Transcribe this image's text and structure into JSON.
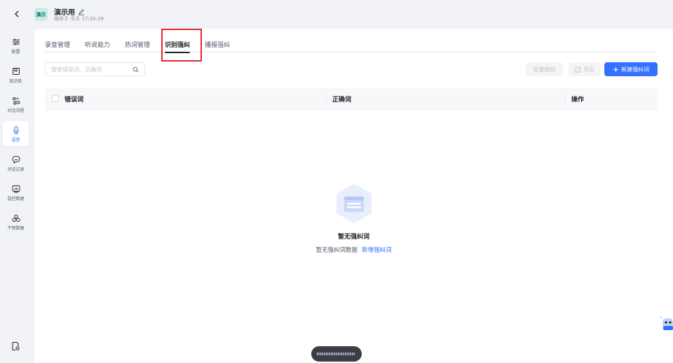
{
  "header": {
    "back_icon": "chevron-left-icon",
    "badge": "演示",
    "title": "演示用",
    "edit_icon": "pencil-icon",
    "save_status": "保存于 今天 17:20:39"
  },
  "sidebar": {
    "items": [
      {
        "label": "配置",
        "icon": "sliders-icon"
      },
      {
        "label": "知识库",
        "icon": "book-icon"
      },
      {
        "label": "对话流程",
        "icon": "flow-icon"
      },
      {
        "label": "语音",
        "icon": "microphone-icon",
        "active": true
      },
      {
        "label": "对话记录",
        "icon": "chat-icon"
      },
      {
        "label": "监控数据",
        "icon": "monitor-chart-icon"
      },
      {
        "label": "干预数据",
        "icon": "nodes-icon"
      }
    ],
    "bottom_icon": "document-settings-icon"
  },
  "tabs": [
    {
      "label": "录音管理"
    },
    {
      "label": "听说能力"
    },
    {
      "label": "热词管理"
    },
    {
      "label": "识别强纠",
      "active": true
    },
    {
      "label": "播报强纠"
    }
  ],
  "search": {
    "placeholder": "搜索错误词、正确词"
  },
  "actions": {
    "batch_delete": "批量删除",
    "export": "导出",
    "new": "新建强纠词"
  },
  "table": {
    "columns": [
      "错误词",
      "正确词",
      "操作"
    ]
  },
  "empty_state": {
    "title": "暂无强纠词",
    "description": "暂无强纠词数据",
    "link": "新增强纠词"
  },
  "colors": {
    "accent": "#3370ff",
    "highlight": "#e5262c",
    "badge_bg": "#c7ece7"
  }
}
